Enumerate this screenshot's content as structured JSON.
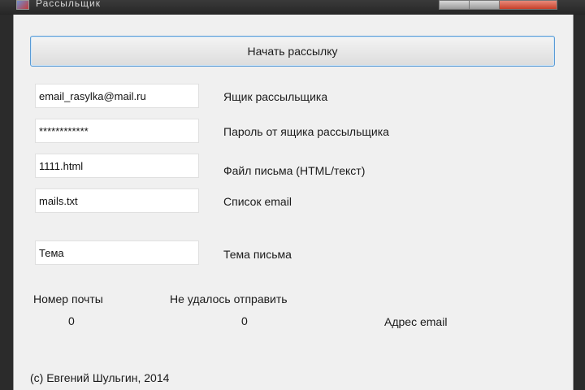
{
  "window": {
    "title": "Рассыльщик"
  },
  "start_button_label": "Начать рассылку",
  "fields": [
    {
      "value": "email_rasylka@mail.ru",
      "label": "Ящик рассыльщика"
    },
    {
      "value": "************",
      "label": "Пароль от ящика рассыльщика"
    },
    {
      "value": "1111.html",
      "label": "Файл письма (HTML/текст)"
    },
    {
      "value": "mails.txt",
      "label": "Список email"
    },
    {
      "value": "Тема",
      "label": "Тема письма"
    }
  ],
  "stats": {
    "mail_number_label": "Номер почты",
    "mail_number_value": "0",
    "failed_label": "Не удалось отправить",
    "failed_value": "0",
    "address_label": "Адрес email"
  },
  "footer": "(с) Евгений Шульгин, 2014"
}
